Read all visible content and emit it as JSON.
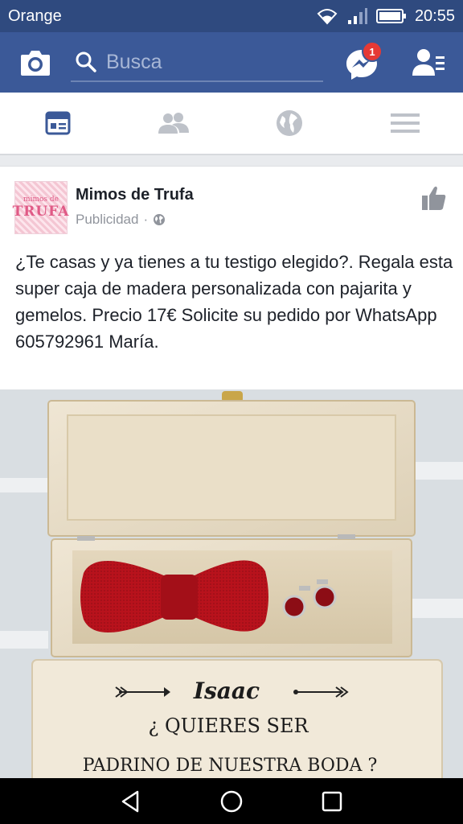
{
  "status_bar": {
    "carrier": "Orange",
    "time": "20:55"
  },
  "top_bar": {
    "search_placeholder": "Busca",
    "messenger_badge": "1"
  },
  "tabs": [
    {
      "name": "news-feed",
      "active": true
    },
    {
      "name": "friends",
      "active": false
    },
    {
      "name": "notifications",
      "active": false
    },
    {
      "name": "menu",
      "active": false
    }
  ],
  "post": {
    "avatar_line1": "mimos de",
    "avatar_line2": "TRUFA",
    "page_name": "Mimos de Trufa",
    "sponsored_label": "Publicidad",
    "text": "¿Te casas y ya tienes a tu testigo elegido?. Regala esta super caja de madera personalizada con pajarita y gemelos.  Precio 17€ Solicite su pedido por WhatsApp 605792961 María.",
    "photo": {
      "name_label": "Isaac",
      "line1": "¿ QUIERES SER",
      "line2": "PADRINO DE  NUESTRA BODA ?"
    }
  },
  "colors": {
    "facebook_blue": "#3b5998",
    "status_bar": "#2f4a7f",
    "badge_red": "#e53935",
    "active_tab": "#3b5998",
    "inactive_tab": "#bec2c9"
  }
}
